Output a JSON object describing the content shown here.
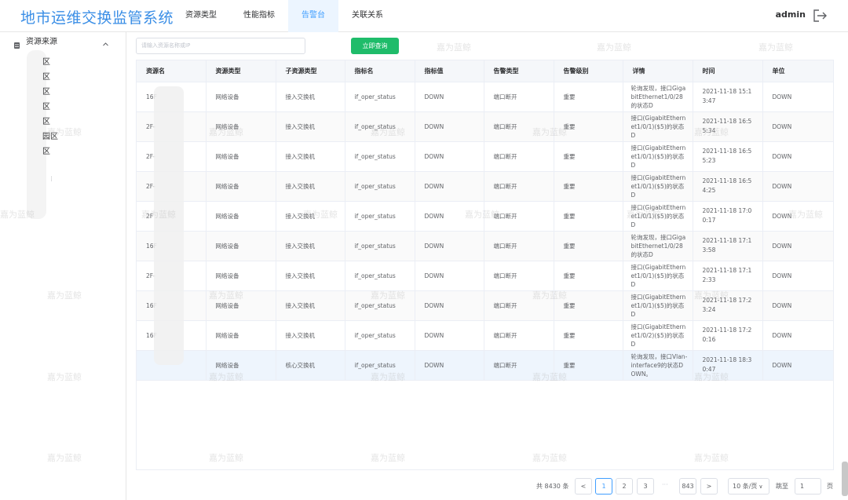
{
  "app": {
    "title": "地市运维交换监管系统",
    "user": "admin"
  },
  "nav": [
    {
      "label": "资源类型"
    },
    {
      "label": "性能指标"
    },
    {
      "label": "告警台"
    },
    {
      "label": "关联关系"
    }
  ],
  "nav_active": "告警台",
  "sidebar": {
    "title": "资源来源",
    "items": [
      "区",
      "区",
      "区",
      "区",
      "区",
      "园区",
      "区"
    ],
    "more": "⋮"
  },
  "search": {
    "placeholder": "请输入资源名称或IP",
    "button": "立即查询"
  },
  "table": {
    "headers": [
      "资源名",
      "资源类型",
      "子资源类型",
      "指标名",
      "指标值",
      "告警类型",
      "告警级别",
      "详情",
      "时间",
      "单位"
    ],
    "rows": [
      [
        "16F",
        "网络设备",
        "接入交换机",
        "if_oper_status",
        "DOWN",
        "端口断开",
        "重要",
        "轮询发现，接口GigabitEthernet1/0/28的状态D",
        "2021-11-18 15:13:47",
        "DOWN"
      ],
      [
        "2F-",
        "网络设备",
        "接入交换机",
        "if_oper_status",
        "DOWN",
        "端口断开",
        "重要",
        "接口(GigabitEthernet1/0/1)($5)的状态D",
        "2021-11-18 16:55:34",
        "DOWN"
      ],
      [
        "2F-",
        "网络设备",
        "接入交换机",
        "if_oper_status",
        "DOWN",
        "端口断开",
        "重要",
        "接口(GigabitEthernet1/0/1)($5)的状态D",
        "2021-11-18 16:55:23",
        "DOWN"
      ],
      [
        "2F-",
        "网络设备",
        "接入交换机",
        "if_oper_status",
        "DOWN",
        "端口断开",
        "重要",
        "接口(GigabitEthernet1/0/1)($5)的状态D",
        "2021-11-18 16:54:25",
        "DOWN"
      ],
      [
        "2F",
        "网络设备",
        "接入交换机",
        "if_oper_status",
        "DOWN",
        "端口断开",
        "重要",
        "接口(GigabitEthernet1/0/1)($5)的状态D",
        "2021-11-18 17:00:17",
        "DOWN"
      ],
      [
        "16F",
        "网络设备",
        "接入交换机",
        "if_oper_status",
        "DOWN",
        "端口断开",
        "重要",
        "轮询发现，接口GigabitEthernet1/0/28的状态D",
        "2021-11-18 17:13:58",
        "DOWN"
      ],
      [
        "2F-",
        "网络设备",
        "接入交换机",
        "if_oper_status",
        "DOWN",
        "端口断开",
        "重要",
        "接口(GigabitEthernet1/0/1)($5)的状态D",
        "2021-11-18 17:12:33",
        "DOWN"
      ],
      [
        "16F",
        "网络设备",
        "接入交换机",
        "if_oper_status",
        "DOWN",
        "端口断开",
        "重要",
        "接口(GigabitEthernet1/0/1)($5)的状态D",
        "2021-11-18 17:23:24",
        "DOWN"
      ],
      [
        "16F",
        "网络设备",
        "接入交换机",
        "if_oper_status",
        "DOWN",
        "端口断开",
        "重要",
        "接口(GigabitEthernet1/0/2)($5)的状态D",
        "2021-11-18 17:20:16",
        "DOWN"
      ],
      [
        "",
        "网络设备",
        "核心交换机",
        "if_oper_status",
        "DOWN",
        "端口断开",
        "重要",
        "轮询发现，接口Vlan-interface9的状态DOWN。",
        "2021-11-18 18:30:47",
        "DOWN"
      ]
    ]
  },
  "pagination": {
    "total": "共 8430 条",
    "prev": "<",
    "pages": [
      "1",
      "2",
      "3"
    ],
    "more": "···",
    "last": "843",
    "next": ">",
    "page_size": "10 条/页",
    "jump_label": "跳至",
    "jump_value": "1",
    "page_suffix": "页"
  },
  "watermark": "嘉为蓝鲸",
  "colors": {
    "brand": "#3a8ee6",
    "primary": "#409eff",
    "search_button": "#1fbc6a"
  },
  "icons": {
    "sidebar": "database-icon",
    "logout": "logout-icon",
    "caret": "chevron-up-icon"
  }
}
